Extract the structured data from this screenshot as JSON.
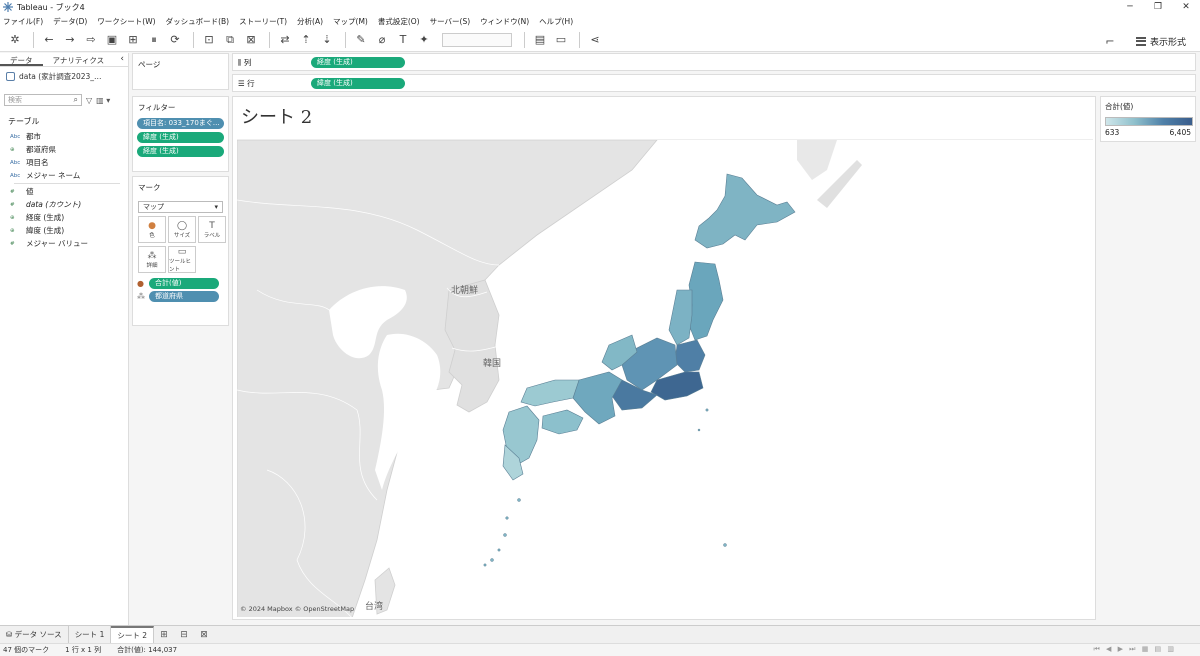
{
  "window": {
    "title": "Tableau - ブック4",
    "minimize": "─",
    "restore": "❐",
    "close": "✕"
  },
  "menu": [
    "ファイル(F)",
    "データ(D)",
    "ワークシート(W)",
    "ダッシュボード(B)",
    "ストーリー(T)",
    "分析(A)",
    "マップ(M)",
    "書式設定(O)",
    "サーバー(S)",
    "ウィンドウ(N)",
    "ヘルプ(H)"
  ],
  "toolbar": {
    "show_me_label": "表示形式"
  },
  "data_pane": {
    "tab_data": "データ",
    "tab_analytics": "アナリティクス",
    "collapse": "‹",
    "datasource_name": "data (家計調査2023_…",
    "search_placeholder": "検索",
    "table_header": "テーブル",
    "fields": [
      {
        "type": "Abc",
        "name": "都市"
      },
      {
        "type": "⊕",
        "name": "都道府県"
      },
      {
        "type": "Abc",
        "name": "項目名"
      },
      {
        "type": "Abc",
        "name": "メジャー ネーム"
      },
      {
        "type": "#",
        "name": "値"
      },
      {
        "type": "#",
        "name": "data (カウント)"
      },
      {
        "type": "⊕",
        "name": "経度 (生成)"
      },
      {
        "type": "⊕",
        "name": "緯度 (生成)"
      },
      {
        "type": "#",
        "name": "メジャー バリュー"
      }
    ]
  },
  "pages": {
    "title": "ページ"
  },
  "filters": {
    "title": "フィルター",
    "pills": [
      "項目名: 033_170まぐ…",
      "緯度 (生成)",
      "経度 (生成)"
    ]
  },
  "marks": {
    "title": "マーク",
    "type": "マップ",
    "buttons": [
      {
        "icon": "●",
        "label": "色"
      },
      {
        "icon": "◯",
        "label": "サイズ"
      },
      {
        "icon": "T",
        "label": "ラベル"
      },
      {
        "icon": "⁂",
        "label": "詳細"
      },
      {
        "icon": "▭",
        "label": "ツールヒント"
      }
    ],
    "pills": [
      "合計(値)",
      "都道府県"
    ]
  },
  "shelves": {
    "columns_label": "列",
    "columns_pill": "経度 (生成)",
    "rows_label": "行",
    "rows_pill": "緯度 (生成)"
  },
  "view": {
    "sheet_title": "シート 2",
    "map_labels": {
      "north_korea": "北朝鮮",
      "korea": "韓国",
      "taiwan": "台湾"
    },
    "attribution": "© 2024 Mapbox © OpenStreetMap"
  },
  "legend": {
    "title": "合計(値)",
    "min": "633",
    "max": "6,405",
    "colors": [
      "#cfe6ea",
      "#3a5d8c"
    ]
  },
  "sheet_tabs": {
    "datasource": "データ ソース",
    "tabs": [
      "シート 1",
      "シート 2"
    ],
    "active": "シート 2"
  },
  "status": {
    "marks": "47 個のマーク",
    "rows_cols": "1 行 x 1 列",
    "sum": "合計(値): 144,037"
  }
}
